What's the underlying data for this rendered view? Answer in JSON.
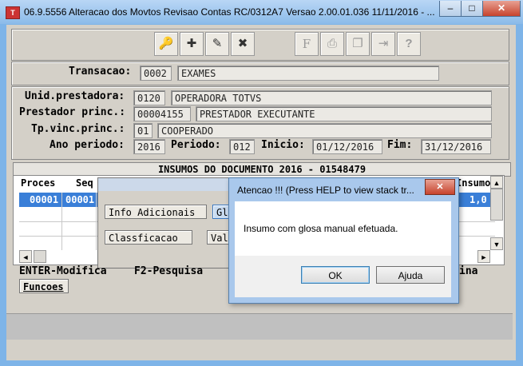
{
  "window": {
    "title": "06.9.5556  Alteracao  dos Movtos Revisao Contas RC/0312A7 Versao 2.00.01.036 11/11/2016 - ...",
    "app_icon_glyph": "T",
    "minimize_glyph": "–",
    "maximize_glyph": "□",
    "close_glyph": "✕"
  },
  "toolbar": {
    "buttons": [
      {
        "name": "key-icon",
        "glyph": "🔑"
      },
      {
        "name": "add-icon",
        "glyph": "✚"
      },
      {
        "name": "edit-icon",
        "glyph": "✎"
      },
      {
        "name": "delete-icon",
        "glyph": "✖"
      },
      {
        "name": "filter-icon",
        "glyph": "F"
      },
      {
        "name": "print-icon",
        "glyph": "⎙"
      },
      {
        "name": "copy-icon",
        "glyph": "❐"
      },
      {
        "name": "exit-icon",
        "glyph": "⇥"
      },
      {
        "name": "help-icon",
        "glyph": "?"
      }
    ]
  },
  "transacao": {
    "label": "Transacao:",
    "code": "0002",
    "desc": "EXAMES"
  },
  "form": {
    "unid_label": "Unid.prestadora:",
    "unid_code": "0120",
    "unid_desc": "OPERADORA TOTVS",
    "prest_label": "Prestador princ.:",
    "prest_code": "00004155",
    "prest_desc": "PRESTADOR EXECUTANTE",
    "tpvinc_label": "Tp.vinc.princ.:",
    "tpvinc_code": "01",
    "tpvinc_desc": "COOPERADO",
    "ano_label": "Ano periodo:",
    "ano_value": "2016",
    "periodo_label": "Periodo:",
    "periodo_value": "012",
    "inicio_label": "Inicio:",
    "inicio_value": "01/12/2016",
    "fim_label": "Fim:",
    "fim_value": "31/12/2016"
  },
  "grid": {
    "title": "INSUMOS DO DOCUMENTO 2016 - 01548479",
    "col_proces": "Proces",
    "col_seq": "Seq",
    "col_insumo": "Insumo",
    "row1_proces": "00001",
    "row1_seq": "00001",
    "row1_value": "1,0",
    "scroll_up": "▲",
    "scroll_down": "▼",
    "scroll_left": "◄",
    "scroll_right": "►"
  },
  "subwindow": {
    "info_btn": "Info Adicionais",
    "gl_btn": "Gl",
    "classif_btn": "Classficacao",
    "val_btn": "Val"
  },
  "footer": {
    "enter_hint": "ENTER-Modifica",
    "f2_hint": "F2-Pesquisa",
    "right_hint": "ina",
    "funcoes_btn": "Funcoes"
  },
  "dialog": {
    "title": "Atencao !!!  (Press HELP to view stack tr...",
    "message": "Insumo com glosa manual efetuada.",
    "ok_label": "OK",
    "help_label": "Ajuda",
    "close_glyph": "✕"
  }
}
